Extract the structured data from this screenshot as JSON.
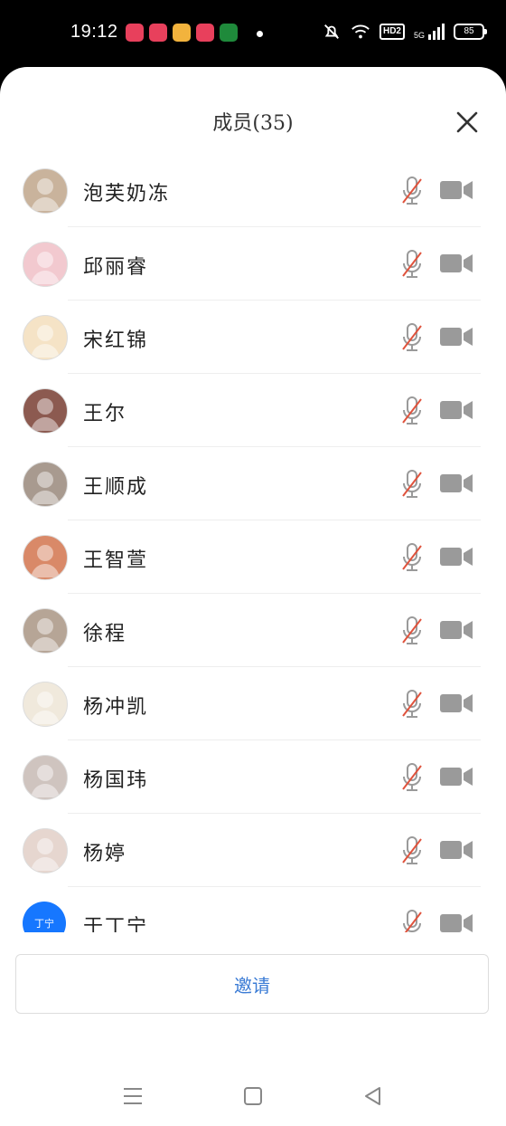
{
  "status_bar": {
    "time": "19:12",
    "network": "HD2",
    "signal": "5G",
    "battery": "85",
    "app_icons": [
      {
        "name": "health-app-icon",
        "color": "#e8405c"
      },
      {
        "name": "video-app-icon",
        "color": "#e8405c"
      },
      {
        "name": "weibo-app-icon",
        "color": "#f2b33d"
      },
      {
        "name": "toutiao-app-icon",
        "color": "#e8405c"
      },
      {
        "name": "oppo-app-icon",
        "color": "#1f8a3b"
      }
    ]
  },
  "sheet": {
    "title": "成员(35)",
    "invite_label": "邀请"
  },
  "members": [
    {
      "name": "泡芙奶冻",
      "avatar_color": "#c9b39c"
    },
    {
      "name": "邱丽睿",
      "avatar_color": "#f2c9cf"
    },
    {
      "name": "宋红锦",
      "avatar_color": "#f5e3c6"
    },
    {
      "name": "王尔",
      "avatar_color": "#8c5a50"
    },
    {
      "name": "王顺成",
      "avatar_color": "#a89a8f"
    },
    {
      "name": "王智萱",
      "avatar_color": "#d98968"
    },
    {
      "name": "徐程",
      "avatar_color": "#b6a596"
    },
    {
      "name": "杨冲凯",
      "avatar_color": "#f0e9dc"
    },
    {
      "name": "杨国玮",
      "avatar_color": "#cfc4bf"
    },
    {
      "name": "杨婷",
      "avatar_color": "#e6d6cf"
    },
    {
      "name": "于丁宁",
      "avatar_color": "#1677ff",
      "avatar_text": "丁宁"
    }
  ],
  "colors": {
    "accent": "#3a7bd5",
    "muted_icon": "#9a9a9a",
    "muted_slash": "#e0533d"
  }
}
